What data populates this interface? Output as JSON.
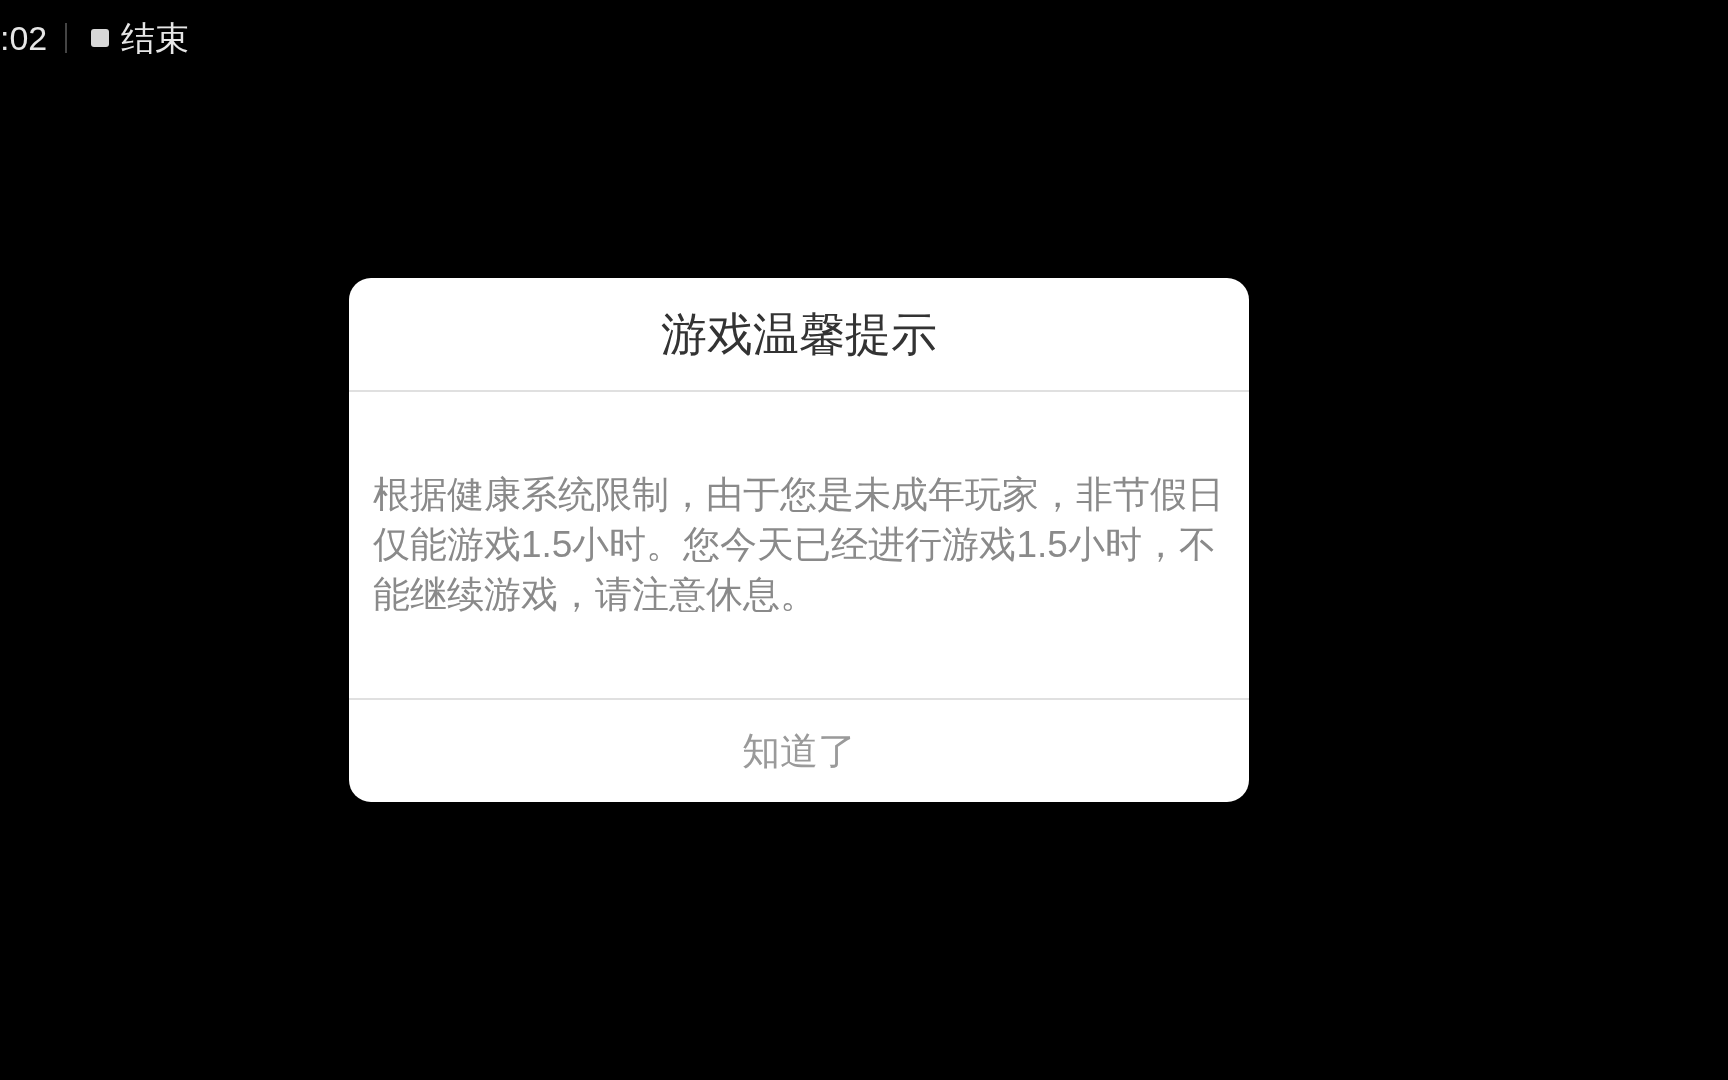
{
  "recording_bar": {
    "time": ":02",
    "stop_label": "结束"
  },
  "dialog": {
    "title": "游戏温馨提示",
    "message": "根据健康系统限制，由于您是未成年玩家，非节假日仅能游戏1.5小时。您今天已经进行游戏1.5小时，不能继续游戏，请注意休息。",
    "button": "知道了"
  }
}
